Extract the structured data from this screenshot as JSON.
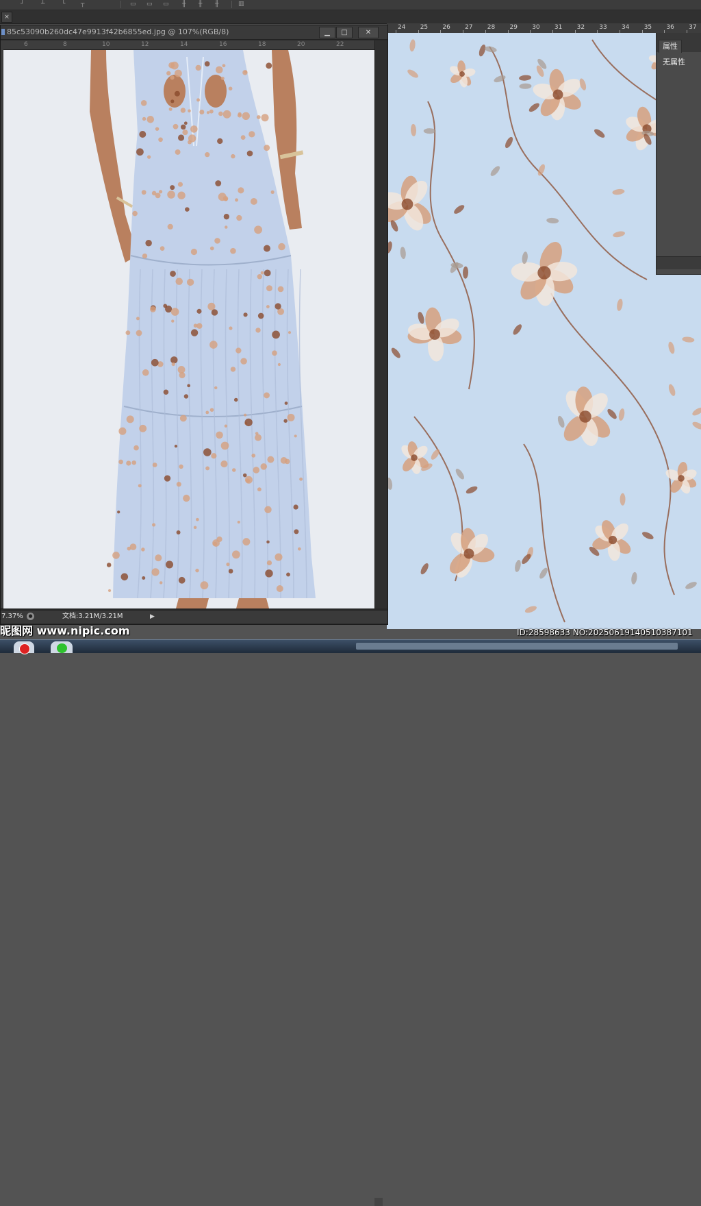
{
  "document": {
    "title": "85c53090b260dc47e9913f42b6855ed.jpg @ 107%(RGB/8)",
    "zoom": "7.37%",
    "doc_size": "文档:3.21M/3.21M",
    "window_controls": [
      "▁",
      "□",
      "✕"
    ]
  },
  "tab_row": {
    "close_glyph": "×"
  },
  "ruler_top": {
    "labels": [
      "24",
      "25",
      "26",
      "27",
      "28",
      "29",
      "30",
      "31",
      "32",
      "33",
      "34",
      "35",
      "36",
      "37"
    ]
  },
  "doc_ruler": {
    "labels": [
      "6",
      "8",
      "10",
      "12",
      "14",
      "16",
      "18",
      "20",
      "22"
    ]
  },
  "properties_panel": {
    "tab_label": "属性",
    "empty_text": "无属性"
  },
  "overlay": {
    "watermark": "昵图网 www.nipic.com",
    "image_id": "ID:28598633 NO:20250619140510387101"
  },
  "colors": {
    "canvas_background": "#c8dbef",
    "dress_fabric": "#c2d1ea",
    "flower_peach": "#d6a07e",
    "flower_rust": "#8a4a2c",
    "app_background": "#535353"
  }
}
